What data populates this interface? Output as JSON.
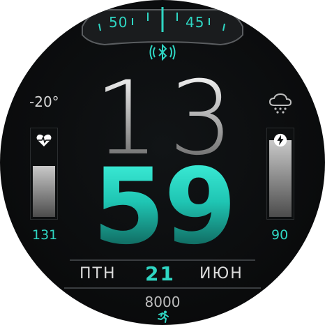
{
  "top_scale": {
    "left_value": "50",
    "right_value": "45"
  },
  "temperature": "-20°",
  "heart": {
    "value": "131",
    "level": 0.6
  },
  "battery": {
    "value": "90",
    "level": 0.9
  },
  "time": {
    "hour": "13",
    "minute": "59"
  },
  "date": {
    "weekday": "ПТН",
    "day": "21",
    "month": "ИЮН"
  },
  "steps": "8000",
  "icons": {
    "bluetooth": "bluetooth-icon",
    "weather": "cloud-snow-icon",
    "heart": "heart-pulse-icon",
    "battery": "charge-icon",
    "run": "running-icon"
  },
  "colors": {
    "accent": "#2fd6c3",
    "text": "#dcdcdc",
    "background": "#0a0b0c"
  }
}
